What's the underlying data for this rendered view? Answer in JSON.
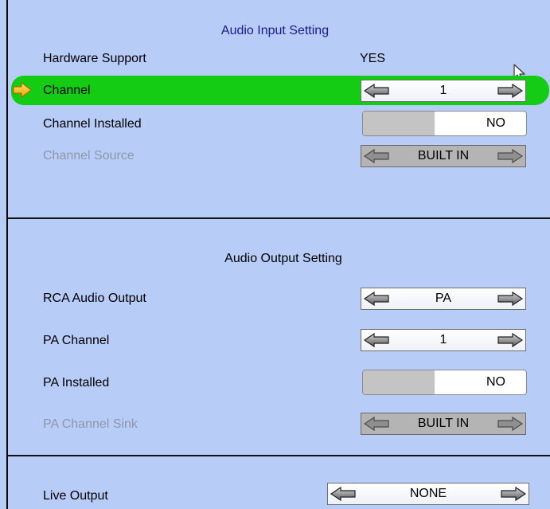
{
  "audio_input": {
    "title": "Audio Input Setting",
    "hardware_support": {
      "label": "Hardware Support",
      "value": "YES"
    },
    "channel": {
      "label": "Channel",
      "value": "1"
    },
    "channel_installed": {
      "label": "Channel Installed",
      "value": "NO"
    },
    "channel_source": {
      "label": "Channel Source",
      "value": "BUILT IN"
    }
  },
  "audio_output": {
    "title": "Audio Output Setting",
    "rca_audio_output": {
      "label": "RCA Audio Output",
      "value": "PA"
    },
    "pa_channel": {
      "label": "PA Channel",
      "value": "1"
    },
    "pa_installed": {
      "label": "PA Installed",
      "value": "NO"
    },
    "pa_channel_sink": {
      "label": "PA Channel Sink",
      "value": "BUILT IN"
    }
  },
  "live_output": {
    "label": "Live Output",
    "value": "NONE"
  },
  "colors": {
    "background": "#b8ccf8",
    "selection_highlight": "#13cc13",
    "section_title_input": "#1a1a8a",
    "disabled_text": "#8d97a8",
    "cursor_arrow": "#ffc800"
  }
}
